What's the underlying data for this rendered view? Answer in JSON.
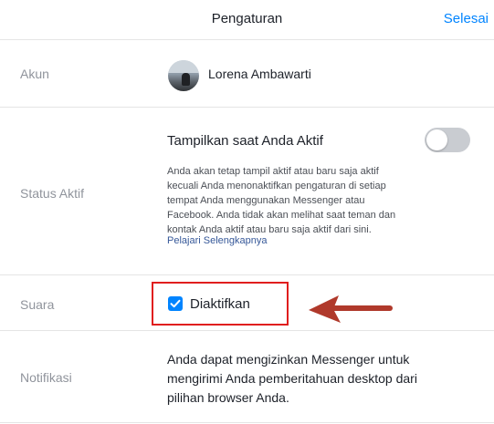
{
  "header": {
    "title": "Pengaturan",
    "done_label": "Selesai"
  },
  "account": {
    "label": "Akun",
    "user_name": "Lorena Ambawarti"
  },
  "active_status": {
    "label": "Status Aktif",
    "title": "Tampilkan saat Anda Aktif",
    "toggle_on": false,
    "description_lines": [
      "Anda akan tetap tampil aktif atau baru saja aktif",
      "kecuali Anda menonaktifkan pengaturan di setiap",
      "tempat Anda menggunakan Messenger atau",
      "Facebook. Anda tidak akan melihat saat teman dan",
      "kontak Anda aktif atau baru saja aktif dari sini."
    ],
    "learn_more": "Pelajari Selengkapnya"
  },
  "sound": {
    "label": "Suara",
    "checked": true,
    "value_label": "Diaktifkan"
  },
  "notifications": {
    "label": "Notifikasi",
    "description_lines": [
      "Anda dapat mengizinkan Messenger untuk",
      "mengirimi Anda pemberitahuan desktop dari",
      "pilihan browser Anda."
    ]
  },
  "colors": {
    "accent": "#0084ff",
    "highlight_box": "#e01e1e",
    "annotation_arrow": "#b0392b",
    "toggle_off": "#c9ccd1"
  },
  "icons": {
    "checkbox": "checkmark-icon",
    "annotation": "arrow-left-icon"
  }
}
